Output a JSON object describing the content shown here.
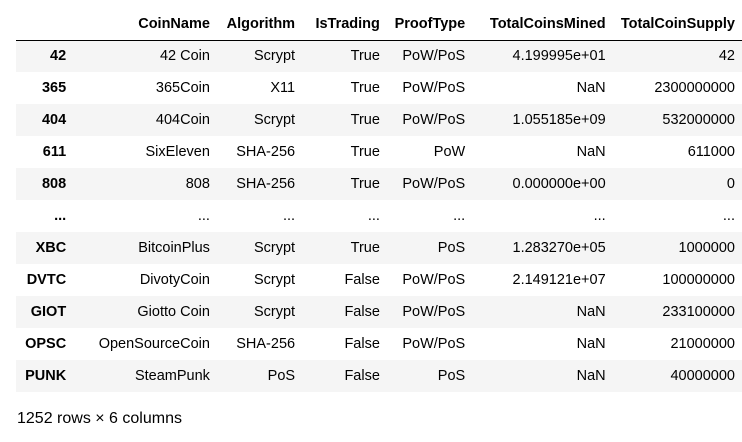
{
  "table": {
    "columns": [
      "",
      "CoinName",
      "Algorithm",
      "IsTrading",
      "ProofType",
      "TotalCoinsMined",
      "TotalCoinSupply"
    ],
    "rows": [
      [
        "42",
        "42 Coin",
        "Scrypt",
        "True",
        "PoW/PoS",
        "4.199995e+01",
        "42"
      ],
      [
        "365",
        "365Coin",
        "X11",
        "True",
        "PoW/PoS",
        "NaN",
        "2300000000"
      ],
      [
        "404",
        "404Coin",
        "Scrypt",
        "True",
        "PoW/PoS",
        "1.055185e+09",
        "532000000"
      ],
      [
        "611",
        "SixEleven",
        "SHA-256",
        "True",
        "PoW",
        "NaN",
        "611000"
      ],
      [
        "808",
        "808",
        "SHA-256",
        "True",
        "PoW/PoS",
        "0.000000e+00",
        "0"
      ],
      [
        "...",
        "...",
        "...",
        "...",
        "...",
        "...",
        "..."
      ],
      [
        "XBC",
        "BitcoinPlus",
        "Scrypt",
        "True",
        "PoS",
        "1.283270e+05",
        "1000000"
      ],
      [
        "DVTC",
        "DivotyCoin",
        "Scrypt",
        "False",
        "PoW/PoS",
        "2.149121e+07",
        "100000000"
      ],
      [
        "GIOT",
        "Giotto Coin",
        "Scrypt",
        "False",
        "PoW/PoS",
        "NaN",
        "233100000"
      ],
      [
        "OPSC",
        "OpenSourceCoin",
        "SHA-256",
        "False",
        "PoW/PoS",
        "NaN",
        "21000000"
      ],
      [
        "PUNK",
        "SteamPunk",
        "PoS",
        "False",
        "PoS",
        "NaN",
        "40000000"
      ]
    ]
  },
  "footer": "1252 rows × 6 columns"
}
